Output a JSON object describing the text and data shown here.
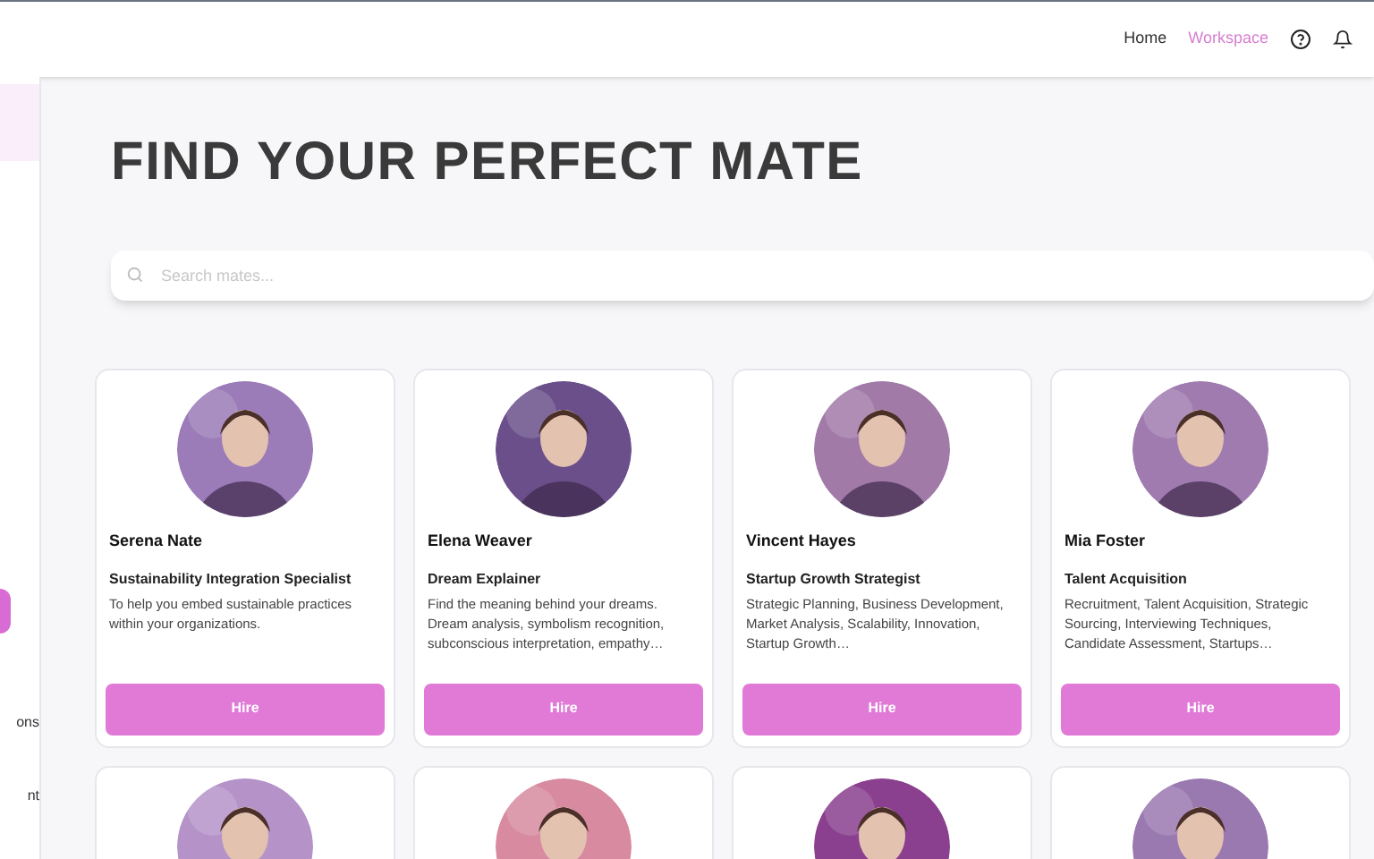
{
  "nav": [
    {
      "label": "Home",
      "selected": false
    },
    {
      "label": "Workspace",
      "selected": true
    }
  ],
  "sidebar": {
    "items": [
      {
        "label": "ons"
      },
      {
        "label": "nt"
      }
    ]
  },
  "title": "FIND YOUR PERFECT MATE",
  "search": {
    "placeholder": "Search mates..."
  },
  "cards": [
    {
      "kind": "full",
      "name": "Serena Nate",
      "role": "Sustainability Integration Specialist",
      "description": "To help you embed sustainable practices within your organizations.",
      "button": "Hire"
    },
    {
      "kind": "full",
      "name": "Elena Weaver",
      "role": "Dream Explainer",
      "description": "Find the meaning behind your dreams. Dream analysis, symbolism recognition, subconscious interpretation, empathy…",
      "button": "Hire"
    },
    {
      "kind": "full",
      "name": "Vincent Hayes",
      "role": "Startup Growth Strategist",
      "description": "Strategic Planning, Business Development, Market Analysis, Scalability, Innovation, Startup Growth…",
      "button": "Hire"
    },
    {
      "kind": "full",
      "name": "Mia Foster",
      "role": "Talent Acquisition",
      "description": "Recruitment, Talent Acquisition, Strategic Sourcing, Interviewing Techniques, Candidate Assessment, Startups…",
      "button": "Hire"
    },
    {
      "kind": "picture"
    },
    {
      "kind": "picture"
    },
    {
      "kind": "picture"
    },
    {
      "kind": "picture"
    }
  ]
}
